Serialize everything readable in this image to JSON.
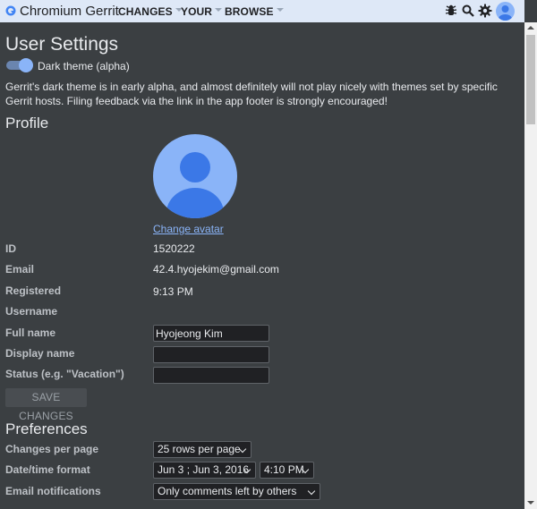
{
  "header": {
    "app_title": "Chromium Gerrit",
    "nav": [
      "CHANGES",
      "YOUR",
      "BROWSE"
    ],
    "icons": [
      "bug-icon",
      "search-icon",
      "gear-icon",
      "account-avatar"
    ]
  },
  "theme": {
    "header_bg": "#dee8f7",
    "body_bg": "#3b3f42",
    "accent": "#8ab4f8"
  },
  "page": {
    "title": "User Settings",
    "dark_theme_label": "Dark theme (alpha)",
    "notice": "Gerrit's dark theme is in early alpha, and almost definitely will not play nicely with themes set by specific Gerrit hosts. Filing feedback via the link in the app footer is strongly encouraged!"
  },
  "profile": {
    "section_title": "Profile",
    "change_avatar": "Change avatar",
    "fields": {
      "id_label": "ID",
      "id_value": "1520222",
      "email_label": "Email",
      "email_value": "42.4.hyojekim@gmail.com",
      "registered_label": "Registered",
      "registered_value": "9:13 PM",
      "username_label": "Username",
      "full_name_label": "Full name",
      "full_name_value": "Hyojeong Kim",
      "display_name_label": "Display name",
      "display_name_value": "",
      "status_label": "Status (e.g. \"Vacation\")",
      "status_value": ""
    },
    "save_button": "SAVE CHANGES"
  },
  "preferences": {
    "section_title": "Preferences",
    "changes_per_page_label": "Changes per page",
    "changes_per_page_value": "25 rows per page",
    "datetime_label": "Date/time format",
    "date_value": "Jun 3 ; Jun 3, 2016",
    "time_value": "4:10 PM",
    "email_notifications_label": "Email notifications",
    "email_notifications_value": "Only comments left by others"
  }
}
